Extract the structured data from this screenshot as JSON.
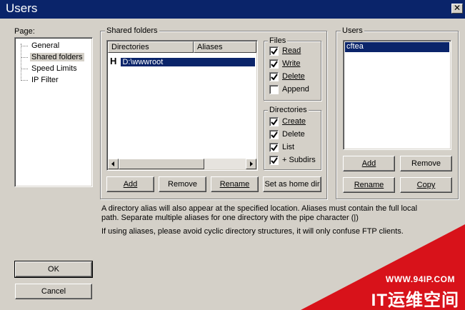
{
  "window": {
    "title": "Users"
  },
  "page_panel": {
    "label": "Page:",
    "items": [
      {
        "label": "General",
        "selected": false
      },
      {
        "label": "Shared folders",
        "selected": true
      },
      {
        "label": "Speed Limits",
        "selected": false
      },
      {
        "label": "IP Filter",
        "selected": false
      }
    ]
  },
  "shared_folders": {
    "label": "Shared folders",
    "columns": [
      "Directories",
      "Aliases"
    ],
    "rows": [
      {
        "marker": "H",
        "directory": "D:\\wwwroot",
        "alias": ""
      }
    ],
    "buttons": {
      "add": "Add",
      "remove": "Remove",
      "rename": "Rename",
      "set_home": "Set as home dir"
    }
  },
  "files": {
    "label": "Files",
    "items": [
      {
        "label": "Read",
        "checked": true
      },
      {
        "label": "Write",
        "checked": true
      },
      {
        "label": "Delete",
        "checked": true
      },
      {
        "label": "Append",
        "checked": false
      }
    ]
  },
  "directories": {
    "label": "Directories",
    "items": [
      {
        "label": "Create",
        "checked": true
      },
      {
        "label": "Delete",
        "checked": true
      },
      {
        "label": "List",
        "checked": true
      },
      {
        "label": "+ Subdirs",
        "checked": true
      }
    ]
  },
  "users_panel": {
    "label": "Users",
    "users": [
      "cftea"
    ],
    "buttons": {
      "add": "Add",
      "remove": "Remove",
      "rename": "Rename",
      "copy": "Copy"
    }
  },
  "info": {
    "line1": "A directory alias will also appear at the specified location. Aliases must contain the full local",
    "line2": "path. Separate multiple aliases for one directory with the pipe character (|)",
    "line3": "If using aliases, please avoid cyclic directory structures, it will only confuse FTP clients."
  },
  "dialog_buttons": {
    "ok": "OK",
    "cancel": "Cancel"
  },
  "watermark": {
    "url": "WWW.94IP.COM",
    "text": "IT运维空间"
  }
}
